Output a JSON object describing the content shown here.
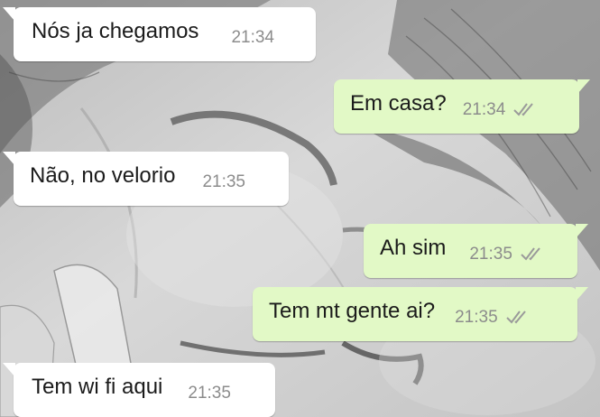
{
  "messages": [
    {
      "direction": "in",
      "text": "Nós ja chegamos",
      "time": "21:34"
    },
    {
      "direction": "out",
      "text": "Em casa?",
      "time": "21:34",
      "status_icon": "double-check-icon"
    },
    {
      "direction": "in",
      "text": "Não, no velorio",
      "time": "21:35"
    },
    {
      "direction": "out",
      "text": "Ah sim",
      "time": "21:35",
      "status_icon": "double-check-icon"
    },
    {
      "direction": "out",
      "text": "Tem mt gente ai?",
      "time": "21:35",
      "status_icon": "double-check-icon"
    },
    {
      "direction": "in",
      "text": "Tem wi fi aqui",
      "time": "21:35"
    }
  ],
  "colors": {
    "incoming_bubble": "#ffffff",
    "outgoing_bubble": "#e2f9c6",
    "timestamp": "#8c8c8c",
    "tick": "#9a9a9a"
  }
}
